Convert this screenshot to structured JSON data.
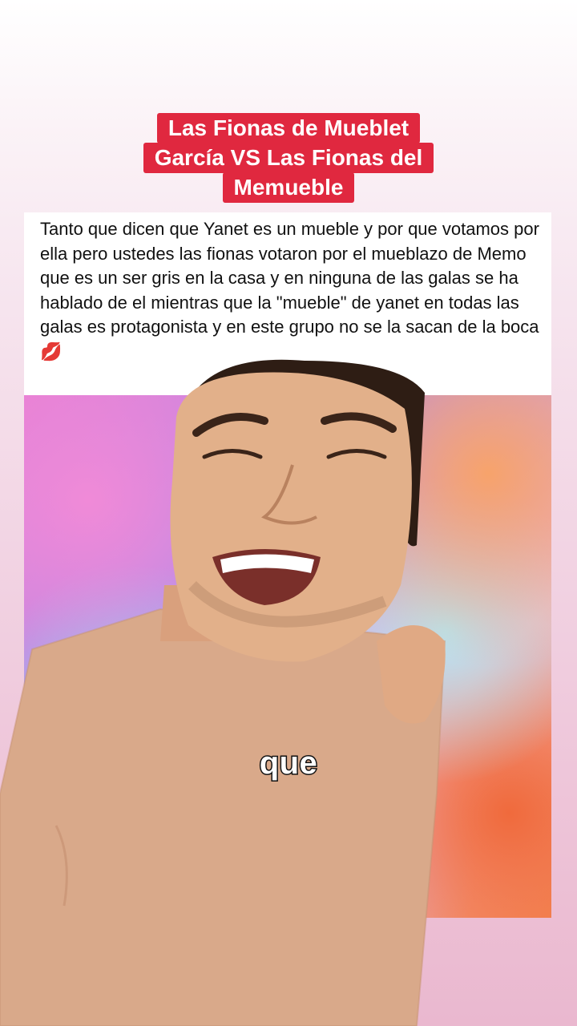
{
  "title": {
    "lines": [
      "Las Fionas de Mueblet",
      "García VS Las Fionas del",
      "Memueble"
    ]
  },
  "post": {
    "text": "Tanto que dicen que Yanet es un mueble y por que votamos por ella pero ustedes las fionas votaron por el mueblazo de Memo que es un ser gris en la casa y en ninguna de las galas se ha hablado de el mientras que la \"mueble\" de yanet en todas las galas es protagonista y en este grupo no se la sacan de la boca 💋"
  },
  "caption": {
    "text": "que"
  },
  "colors": {
    "banner": "#e0283f",
    "banner_text": "#ffffff",
    "skin": "#e2b08a",
    "shirt": "#d9a98a",
    "hair": "#2e1d14"
  }
}
